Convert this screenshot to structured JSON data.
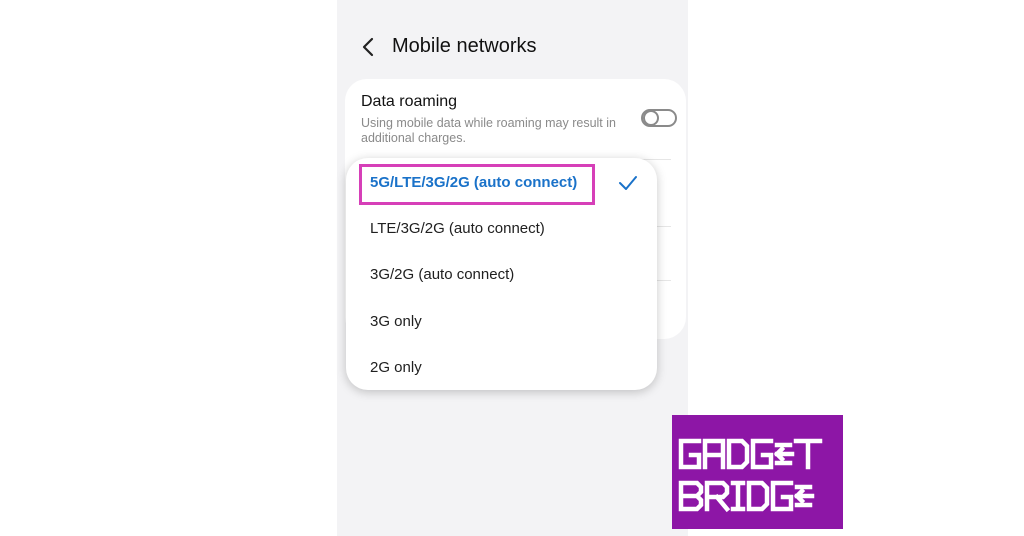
{
  "header": {
    "back_icon": "chevron-left-icon",
    "title": "Mobile networks"
  },
  "data_roaming": {
    "title": "Data roaming",
    "description": "Using mobile data while roaming may result in additional charges.",
    "enabled": false
  },
  "network_mode": {
    "options": [
      {
        "label": "5G/LTE/3G/2G (auto connect)",
        "selected": true
      },
      {
        "label": "LTE/3G/2G (auto connect)",
        "selected": false
      },
      {
        "label": "3G/2G (auto connect)",
        "selected": false
      },
      {
        "label": "3G only",
        "selected": false
      },
      {
        "label": "2G only",
        "selected": false
      }
    ],
    "check_icon": "checkmark-icon"
  },
  "watermark": {
    "line1": "GADGET",
    "line2": "BRIDGE"
  },
  "colors": {
    "selected": "#1a72c9",
    "highlight_box": "#d63fb8",
    "logo_background": "#8d16a6"
  }
}
